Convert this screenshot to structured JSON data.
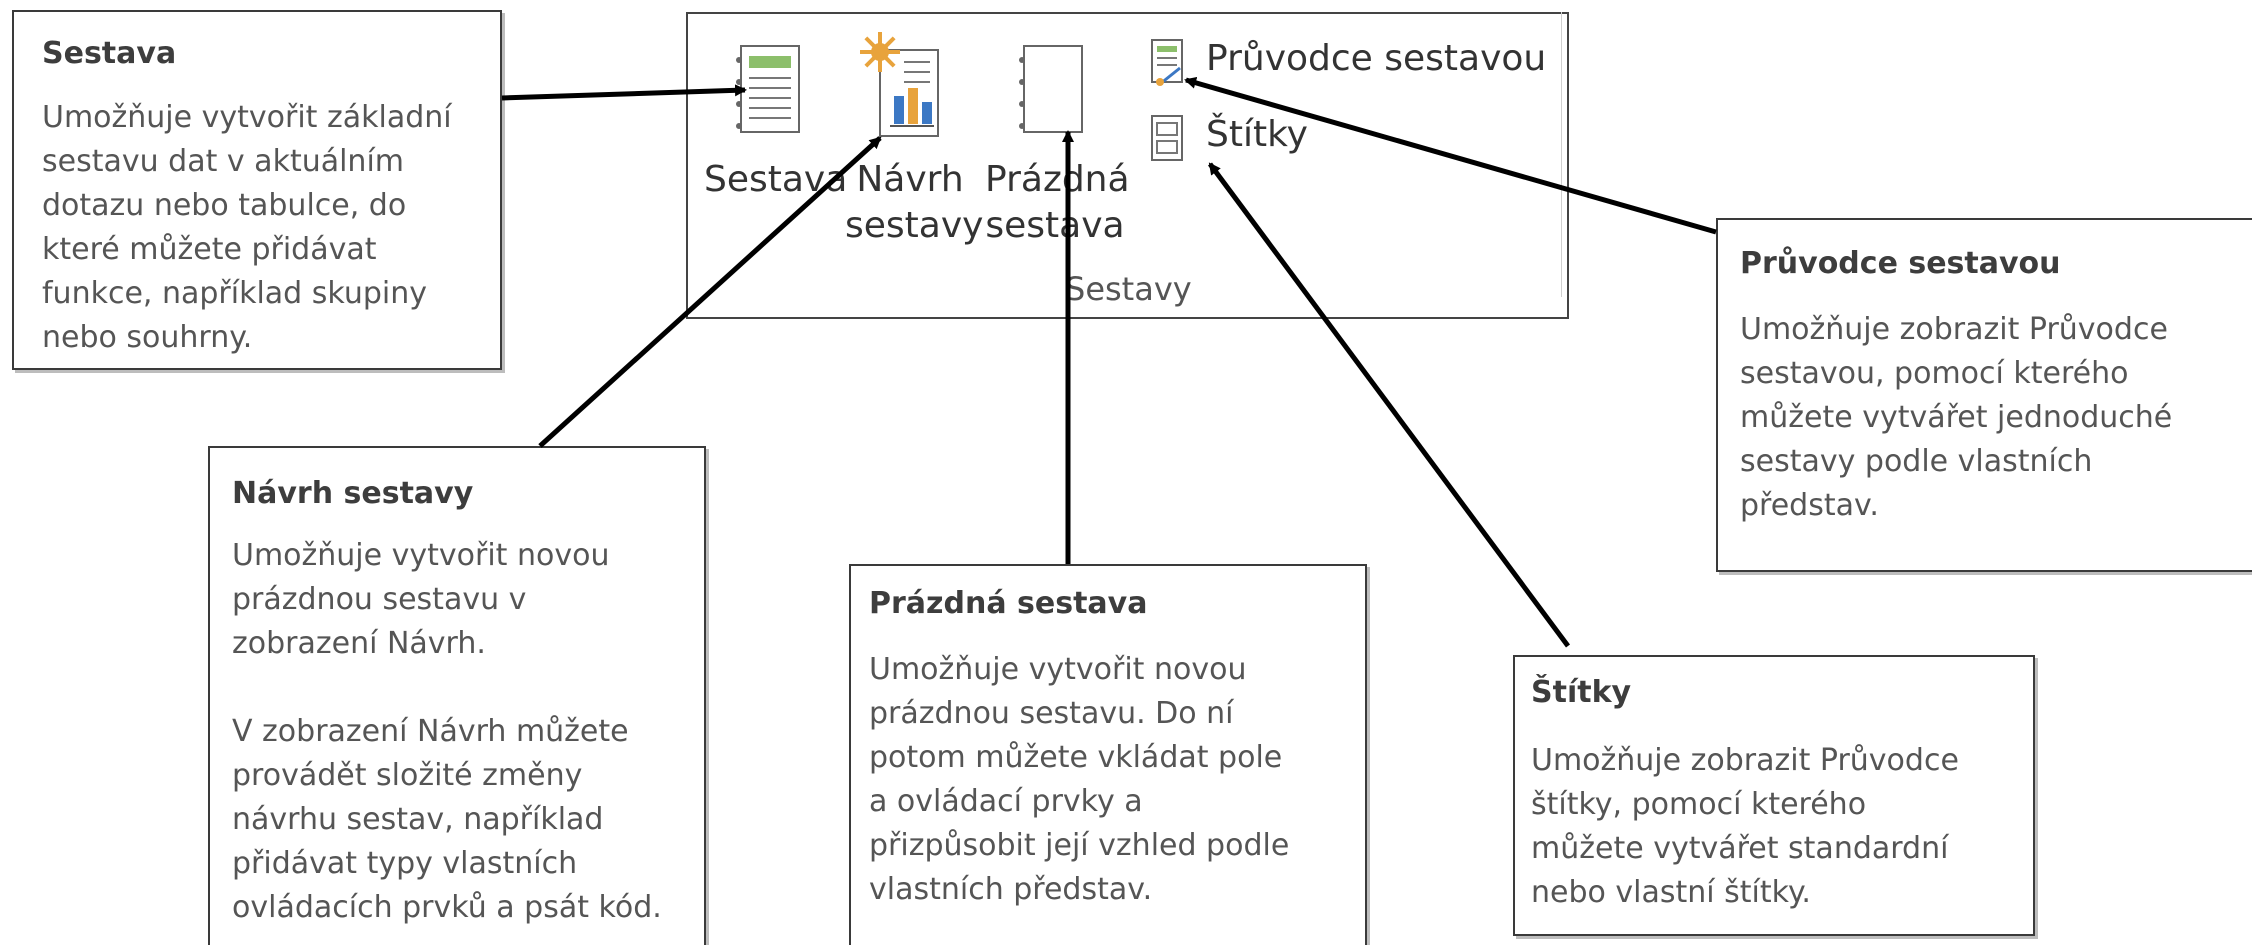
{
  "ribbon": {
    "group_label": "Sestavy",
    "buttons": {
      "sestava": {
        "line1": "Sestava"
      },
      "navrh": {
        "line1": "Návrh",
        "line2": "sestavy"
      },
      "prazdna": {
        "line1": "Prázdná",
        "line2": "sestava"
      },
      "pruvodce": {
        "label": "Průvodce sestavou"
      },
      "stitky": {
        "label": "Štítky"
      }
    }
  },
  "tooltips": {
    "sestava": {
      "title": "Sestava",
      "lines": [
        "Umožňuje vytvořit základní",
        "sestavu dat v aktuálním",
        "dotazu nebo tabulce, do",
        "které můžete přidávat",
        "funkce, například skupiny",
        "nebo souhrny."
      ]
    },
    "navrh": {
      "title": "Návrh sestavy",
      "lines": [
        "Umožňuje vytvořit novou",
        "prázdnou sestavu v",
        "zobrazení Návrh.",
        "",
        "V zobrazení Návrh můžete",
        "provádět složité změny",
        "návrhu sestav, například",
        "přidávat typy vlastních",
        "ovládacích prvků a psát kód."
      ]
    },
    "prazdna": {
      "title": "Prázdná sestava",
      "lines": [
        "Umožňuje vytvořit novou",
        "prázdnou sestavu. Do ní",
        "potom můžete vkládat pole",
        "a ovládací prvky a",
        "přizpůsobit její vzhled podle",
        "vlastních představ."
      ]
    },
    "pruvodce": {
      "title": "Průvodce sestavou",
      "lines": [
        "Umožňuje zobrazit Průvodce",
        "sestavou, pomocí kterého",
        "můžete vytvářet jednoduché",
        "sestavy podle vlastních",
        "představ."
      ]
    },
    "stitky": {
      "title": "Štítky",
      "lines": [
        "Umožňuje zobrazit Průvodce",
        "štítky, pomocí kterého",
        "můžete vytvářet standardní",
        "nebo vlastní štítky."
      ]
    }
  },
  "colors": {
    "border": "#3a3a3a",
    "icon_green": "#8cbf6b",
    "icon_blue": "#3c78c4",
    "icon_orange": "#e8a33c",
    "arrow": "#000000"
  }
}
